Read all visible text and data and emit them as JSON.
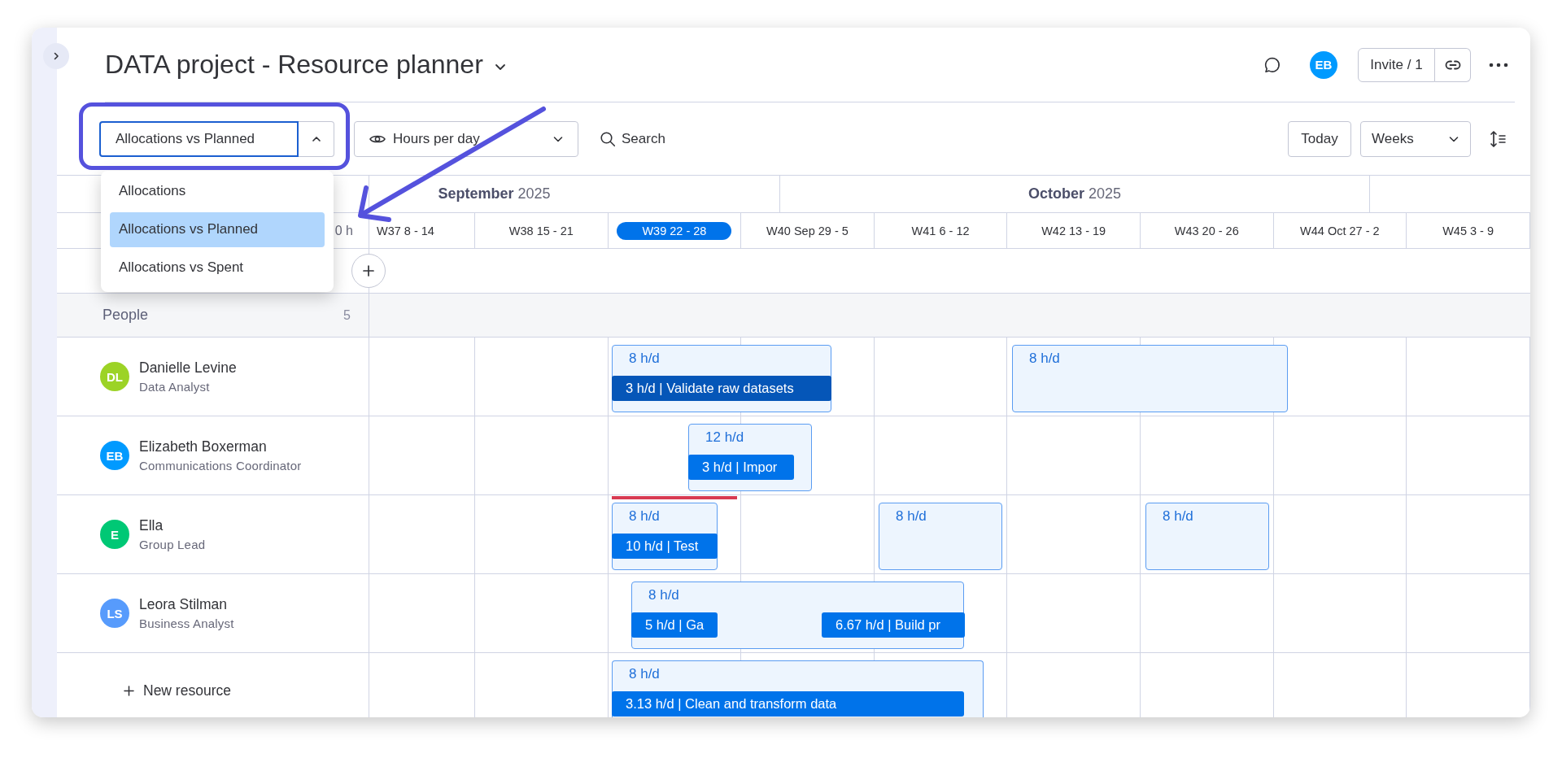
{
  "title": "DATA project - Resource planner",
  "header": {
    "avatar": {
      "initials": "EB"
    },
    "invite_button": "Invite / 1"
  },
  "toolbar": {
    "view_select": {
      "value": "Allocations vs Planned",
      "expanded": true,
      "options": [
        {
          "label": "Allocations",
          "selected": false
        },
        {
          "label": "Allocations vs Planned",
          "selected": true
        },
        {
          "label": "Allocations vs Spent",
          "selected": false
        }
      ]
    },
    "display_select": {
      "value": "Hours per day"
    },
    "search": {
      "label": "Search"
    },
    "today_button": "Today",
    "scale_select": {
      "value": "Weeks"
    }
  },
  "timeline": {
    "months": [
      {
        "label": "**September** 2025"
      },
      {
        "label": "**October** 2025"
      }
    ],
    "total": "0 h",
    "weeks": [
      {
        "label": "W37 8 - 14",
        "current": false
      },
      {
        "label": "W38 15 - 21",
        "current": false
      },
      {
        "label": "W39 22 - 28",
        "current": true
      },
      {
        "label": "W40 Sep 29 - 5",
        "current": false
      },
      {
        "label": "W41 6 - 12",
        "current": false
      },
      {
        "label": "W42 13 - 19",
        "current": false
      },
      {
        "label": "W43 20 - 26",
        "current": false
      },
      {
        "label": "W44 Oct 27 - 2",
        "current": false
      },
      {
        "label": "W45 3 - 9",
        "current": false
      }
    ],
    "group": {
      "label": "People",
      "count": "5"
    },
    "people": [
      {
        "initials": "DL",
        "name": "Danielle Levine",
        "role": "Data Analyst",
        "color": "#9cd326",
        "allocations": [
          {
            "planned": "8 h/d",
            "overbooked": false,
            "tasks": [
              {
                "label": "3 h/d | Validate raw datasets",
                "color": "#0556b8"
              }
            ]
          },
          {
            "planned": "8 h/d",
            "overbooked": false
          }
        ]
      },
      {
        "initials": "EB",
        "name": "Elizabeth Boxerman",
        "role": "Communications Coordinator",
        "color": "#009aff",
        "allocations": [
          {
            "planned": "12 h/d",
            "overbooked": false,
            "tasks": [
              {
                "label": "3 h/d | Impor",
                "color": "#0073ea"
              }
            ]
          }
        ]
      },
      {
        "initials": "E",
        "name": "Ella",
        "role": "Group Lead",
        "color": "#00c875",
        "allocations": [
          {
            "planned": "8 h/d",
            "overbooked": true,
            "tasks": [
              {
                "label": "10 h/d | Test",
                "color": "#0073ea"
              }
            ]
          },
          {
            "planned": "8 h/d",
            "overbooked": false
          },
          {
            "planned": "8 h/d",
            "overbooked": false
          }
        ]
      },
      {
        "initials": "LS",
        "name": "Leora Stilman",
        "role": "Business Analyst",
        "color": "#579bfc",
        "allocations": [
          {
            "planned": "8 h/d",
            "overbooked": false,
            "tasks": [
              {
                "label": "5 h/d | Ga",
                "color": "#0073ea"
              },
              {
                "label": "6.67 h/d | Build pr",
                "color": "#0073ea"
              }
            ]
          }
        ]
      }
    ],
    "footer_row": {
      "new_resource": "New resource",
      "allocations": [
        {
          "planned": "8 h/d",
          "overbooked": false,
          "tasks": [
            {
              "label": "3.13 h/d | Clean and transform data",
              "color": "#0073ea"
            }
          ]
        }
      ]
    }
  }
}
